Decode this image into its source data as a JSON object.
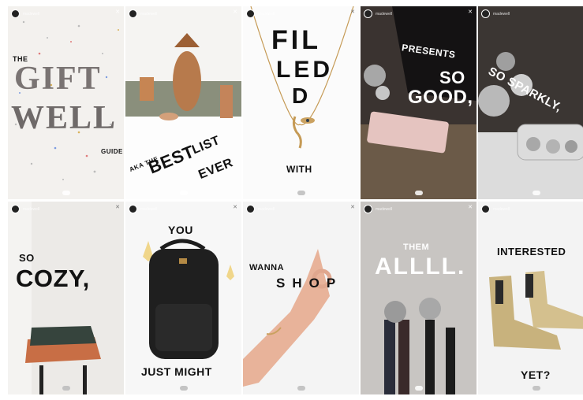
{
  "cards": [
    {
      "user": "madewell",
      "texts": [
        "THE",
        "GIFT",
        "WELL",
        "GUIDE"
      ]
    },
    {
      "user": "madewell",
      "texts": [
        "AKA THE",
        "BEST",
        "LIST",
        "EVER"
      ]
    },
    {
      "user": "madewell",
      "texts": [
        "FIL",
        "LED",
        "D",
        "WITH"
      ]
    },
    {
      "user": "madewell",
      "texts": [
        "PRESENTS",
        "SO",
        "GOOD,"
      ]
    },
    {
      "user": "madewell",
      "texts": [
        "SO SPARKLY,"
      ]
    },
    {
      "user": "madewell",
      "texts": [
        "SO",
        "COZY,"
      ]
    },
    {
      "user": "madewell",
      "texts": [
        "YOU",
        "JUST MIGHT"
      ]
    },
    {
      "user": "madewell",
      "texts": [
        "WANNA",
        "SHOP"
      ]
    },
    {
      "user": "madewell",
      "texts": [
        "THEM",
        "ALLLL."
      ]
    },
    {
      "user": "madewell",
      "texts": [
        "INTERESTED",
        "YET?"
      ]
    }
  ],
  "icons": {
    "close": "✕"
  },
  "colors": {
    "accent": "#111111"
  }
}
